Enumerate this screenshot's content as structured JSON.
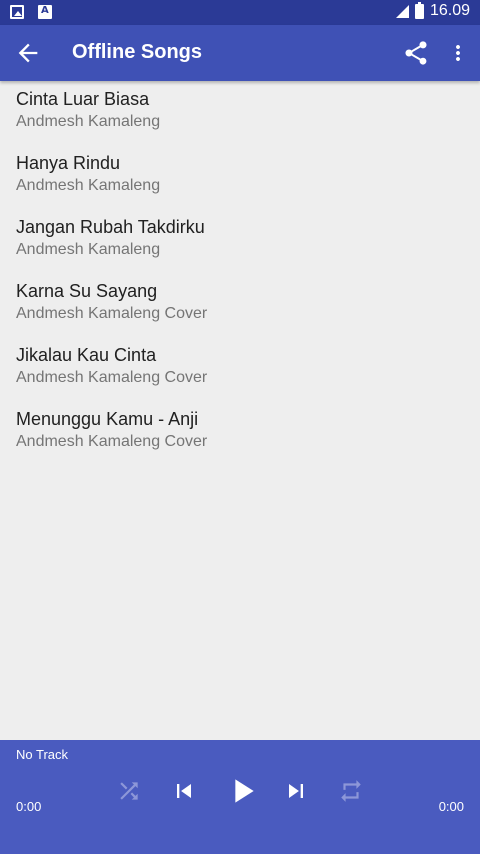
{
  "status_bar": {
    "time": "16.09",
    "icons": [
      "image-notification-icon",
      "font-notification-icon",
      "signal-icon",
      "battery-icon"
    ]
  },
  "app_bar": {
    "title": "Offline Songs",
    "background": "#3f51b5",
    "icons": [
      "back-arrow-icon",
      "share-icon",
      "more-vert-icon"
    ]
  },
  "songs": [
    {
      "title": "Cinta Luar Biasa",
      "artist": "Andmesh Kamaleng"
    },
    {
      "title": "Hanya Rindu",
      "artist": "Andmesh Kamaleng"
    },
    {
      "title": "Jangan Rubah Takdirku",
      "artist": "Andmesh Kamaleng"
    },
    {
      "title": "Karna Su Sayang",
      "artist": "Andmesh Kamaleng Cover"
    },
    {
      "title": "Jikalau Kau Cinta",
      "artist": "Andmesh Kamaleng Cover"
    },
    {
      "title": "Menunggu Kamu - Anji",
      "artist": "Andmesh Kamaleng Cover"
    }
  ],
  "player": {
    "track": "No Track",
    "elapsed": "0:00",
    "duration": "0:00",
    "background": "#4a5bbf",
    "controls": [
      "shuffle-icon",
      "skip-previous-icon",
      "play-icon",
      "skip-next-icon",
      "repeat-icon"
    ]
  }
}
